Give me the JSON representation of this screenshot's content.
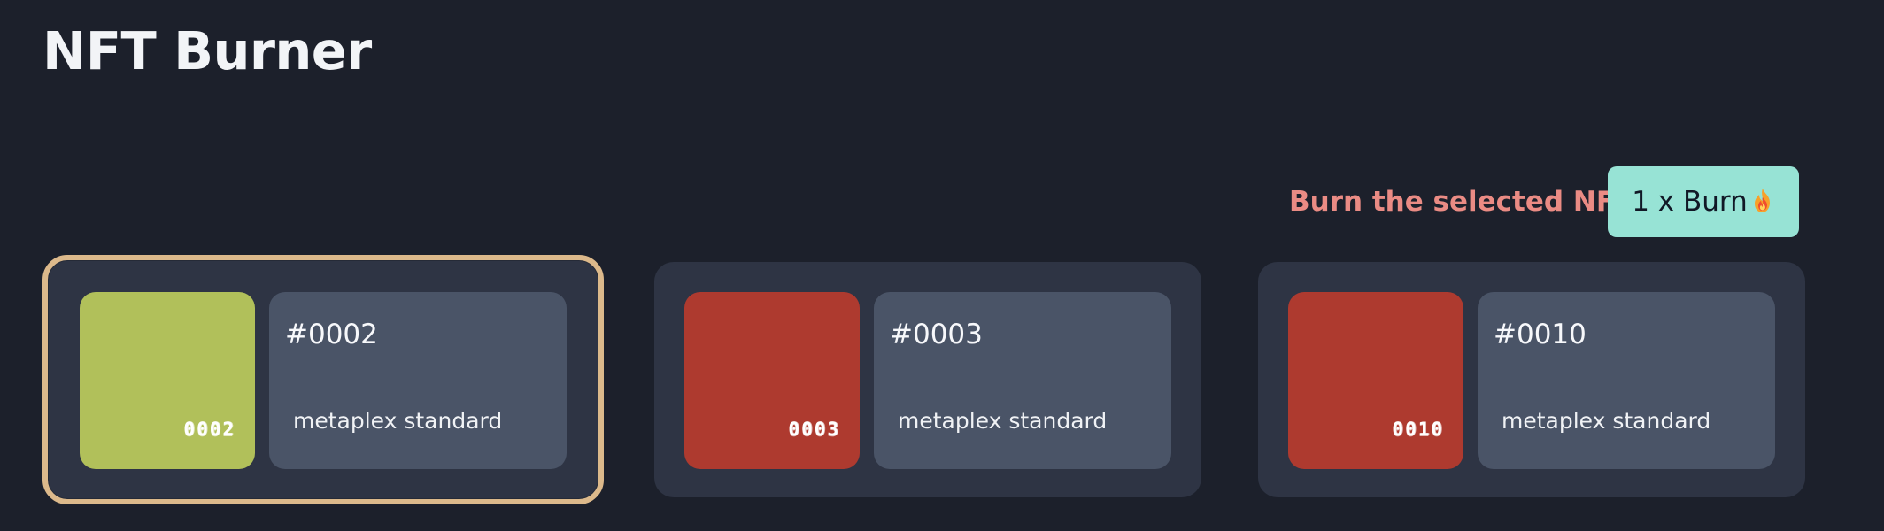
{
  "app": {
    "title": "NFT Burner"
  },
  "burn": {
    "label": "Burn the selected NFT",
    "button_label": "1 x Burn",
    "button_icon": "flame-icon"
  },
  "colors": {
    "background": "#1c202b",
    "card_background": "#2e3444",
    "info_background": "#4a5467",
    "selected_border": "#dcb98b",
    "burn_text": "#ea8b84",
    "burn_button": "#97e3d5"
  },
  "nfts": [
    {
      "selected": true,
      "image_color": "#b1c05a",
      "image_code": "0002",
      "number": "#0002",
      "standard": "metaplex standard"
    },
    {
      "selected": false,
      "image_color": "#ae3a2f",
      "image_code": "0003",
      "number": "#0003",
      "standard": "metaplex standard"
    },
    {
      "selected": false,
      "image_color": "#ae3a2f",
      "image_code": "0010",
      "number": "#0010",
      "standard": "metaplex standard"
    }
  ]
}
